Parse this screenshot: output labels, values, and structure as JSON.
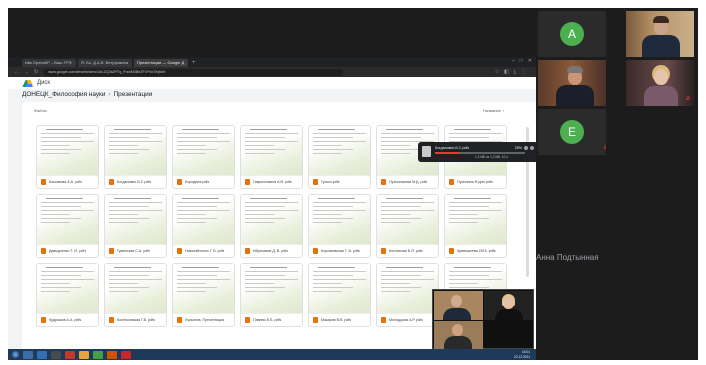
{
  "browser": {
    "tabs": [
      "Ивк ОрениКР – Ваш ТРФ",
      "Я. Бо. Д.А.В. Ветрушкина",
      "Презентации — Google Д"
    ],
    "url": "www.google.com/drive/folders/1IkLZQ2s2PTq_FrzwM3BeZFVF9oTlhjtdr9"
  },
  "disk": {
    "brand": "Диск",
    "breadcrumb": [
      "ДОНЕЦК_Философия науки",
      "Презентации"
    ],
    "files_label": "Файлы",
    "sort_label": "Название"
  },
  "files": [
    "Баскакова А.А. pdfs",
    "Богданович В.С pdfs",
    "Бородина.pdfs",
    "Гаврилочкина А.В. pdfs",
    "Гусько.pdfs",
    "Пузынникова М.Д. pdfs",
    "Пузынина Ф.pptx.pdfs",
    "Давыдченко Т. И. pdf's",
    "Гуменская С.А. pdfs",
    "Николайченко Г. В. pdfs",
    "Ибрагимов Д. В. pdfs",
    "Корсаковская Т. В. pdfs",
    "Колчанова Б.Я. pdfs",
    "Кривошеева 2015 .pdfs",
    "Кудряшов А.А. pdfs",
    "Костюковская Г.В. pdfs",
    "Лукьянов. Презентация",
    "Павлюк Е.Б. pdfs",
    "Макаров В.В. pdfs",
    "Молодцова А.Р. pdfs",
    ""
  ],
  "download": {
    "file_name": "Богданович В.С.pdfs",
    "percent": "28%",
    "status": "1,2 МБ из 1,2 МБ, 10 с",
    "progress": 0.28
  },
  "taskbar": {
    "time": "14:01",
    "date": "22.12.2021"
  },
  "participants": [
    {
      "initial": "A",
      "name": ""
    },
    {
      "initial": "E",
      "name": ""
    }
  ],
  "active_speaker_name": "Анна Подтынная",
  "colors": {
    "avatar_green": "#4caf50",
    "pdf_orange": "#e8710a",
    "download_red": "#e53935",
    "taskbar_blue": "#1e3a5a"
  }
}
